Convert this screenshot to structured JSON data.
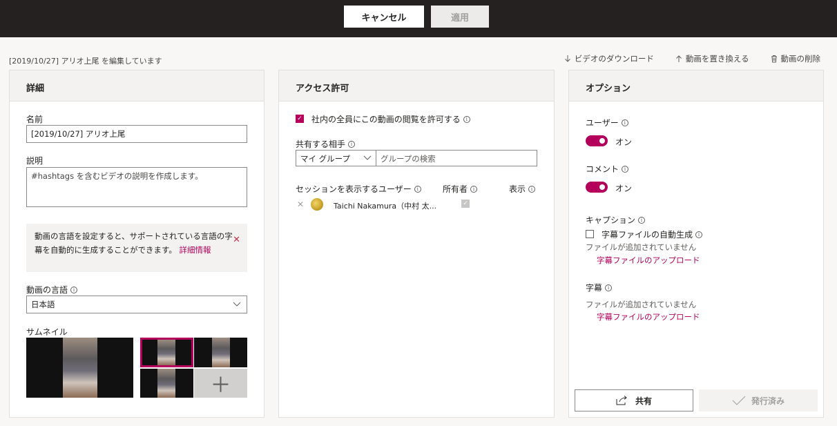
{
  "topbar": {
    "cancel_label": "キャンセル",
    "apply_label": "適用"
  },
  "editing_text": "[2019/10/27] アリオ上尾 を編集しています",
  "actions": {
    "download": "ビデオのダウンロード",
    "replace": "動画を置き換える",
    "delete": "動画の削除"
  },
  "details": {
    "title": "詳細",
    "name_label": "名前",
    "name_value": "[2019/10/27] アリオ上尾",
    "description_label": "説明",
    "description_placeholder": "#hashtags を含むビデオの説明を作成します。",
    "notice_text": "動画の言語を設定すると、サポートされている言語の字幕を自動的に生成することができます。",
    "notice_link": "詳細情報",
    "language_label": "動画の言語",
    "language_value": "日本語",
    "thumbnail_label": "サムネイル"
  },
  "access": {
    "title": "アクセス許可",
    "allow_all_label": "社内の全員にこの動画の閲覧を許可する",
    "share_with_label": "共有する相手",
    "group_select": "マイ グループ",
    "group_search_placeholder": "グループの検索",
    "col_users": "セッションを表示するユーザー",
    "col_owner": "所有者",
    "col_view": "表示",
    "users": [
      {
        "name": "Taichi Nakamura（中村 太..."
      }
    ]
  },
  "options": {
    "title": "オプション",
    "users_label": "ユーザー",
    "users_toggle": "オン",
    "comments_label": "コメント",
    "comments_toggle": "オン",
    "captions_label": "キャプション",
    "autogen_label": "字幕ファイルの自動生成",
    "captions_no_file": "ファイルが追加されていません",
    "captions_upload": "字幕ファイルのアップロード",
    "subtitles_label": "字幕",
    "subtitles_no_file": "ファイルが追加されていません",
    "subtitles_upload": "字幕ファイルのアップロード",
    "share_label": "共有",
    "published_label": "発行済み"
  },
  "colors": {
    "accent": "#b4005a",
    "topbar": "#252120"
  }
}
